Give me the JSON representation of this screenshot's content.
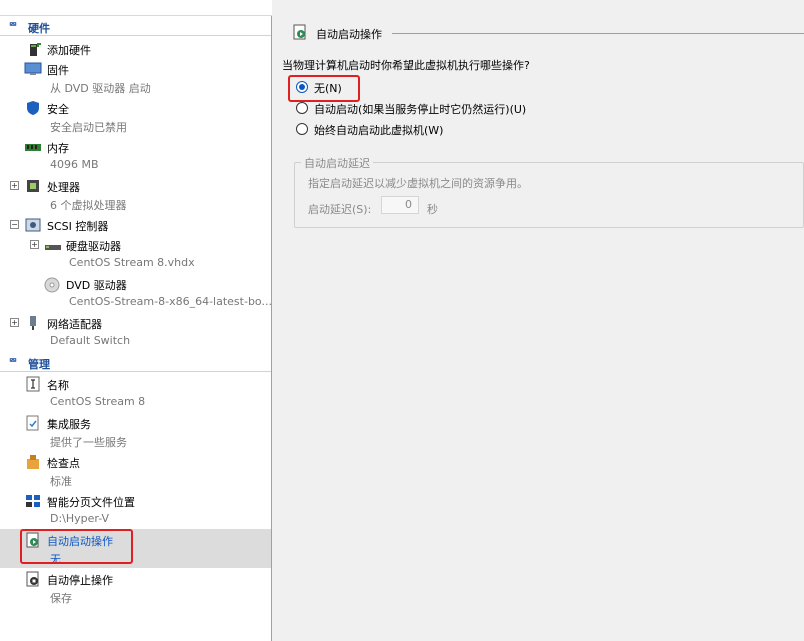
{
  "colors": {
    "accent": "#1f4e99",
    "selected_text": "#0b57c4",
    "highlight_box": "#e02020"
  },
  "sidebar": {
    "hardware_header": "硬件",
    "management_header": "管理",
    "hardware_items": [
      {
        "label": "添加硬件",
        "sub": "",
        "icon": "add-hardware-icon"
      },
      {
        "label": "固件",
        "sub": "从 DVD 驱动器 启动",
        "icon": "firmware-icon"
      },
      {
        "label": "安全",
        "sub": "安全启动已禁用",
        "icon": "security-shield-icon"
      },
      {
        "label": "内存",
        "sub": "4096 MB",
        "icon": "memory-icon"
      },
      {
        "label": "处理器",
        "sub": "6 个虚拟处理器",
        "icon": "processor-icon"
      },
      {
        "label": "SCSI 控制器",
        "sub": "",
        "icon": "scsi-controller-icon"
      },
      {
        "label": "硬盘驱动器",
        "sub": "CentOS Stream 8.vhdx",
        "icon": "hard-drive-icon"
      },
      {
        "label": "DVD 驱动器",
        "sub": "CentOS-Stream-8-x86_64-latest-bo...",
        "icon": "dvd-drive-icon"
      },
      {
        "label": "网络适配器",
        "sub": "Default Switch",
        "icon": "network-adapter-icon"
      }
    ],
    "management_items": [
      {
        "label": "名称",
        "sub": "CentOS Stream 8",
        "icon": "name-icon"
      },
      {
        "label": "集成服务",
        "sub": "提供了一些服务",
        "icon": "integration-services-icon"
      },
      {
        "label": "检查点",
        "sub": "标准",
        "icon": "checkpoint-icon"
      },
      {
        "label": "智能分页文件位置",
        "sub": "D:\\Hyper-V",
        "icon": "smart-paging-icon"
      },
      {
        "label": "自动启动操作",
        "sub": "无",
        "icon": "auto-start-icon"
      },
      {
        "label": "自动停止操作",
        "sub": "保存",
        "icon": "auto-stop-icon"
      }
    ]
  },
  "main": {
    "title": "自动启动操作",
    "question": "当物理计算机启动时你希望此虚拟机执行哪些操作?",
    "options": [
      {
        "label": "无(N)",
        "selected": true
      },
      {
        "label": "自动启动(如果当服务停止时它仍然运行)(U)",
        "selected": false
      },
      {
        "label": "始终自动启动此虚拟机(W)",
        "selected": false
      }
    ],
    "delay_group": {
      "legend": "自动启动延迟",
      "description": "指定启动延迟以减少虚拟机之间的资源争用。",
      "delay_label": "启动延迟(S):",
      "delay_value": "0",
      "unit": "秒"
    }
  }
}
